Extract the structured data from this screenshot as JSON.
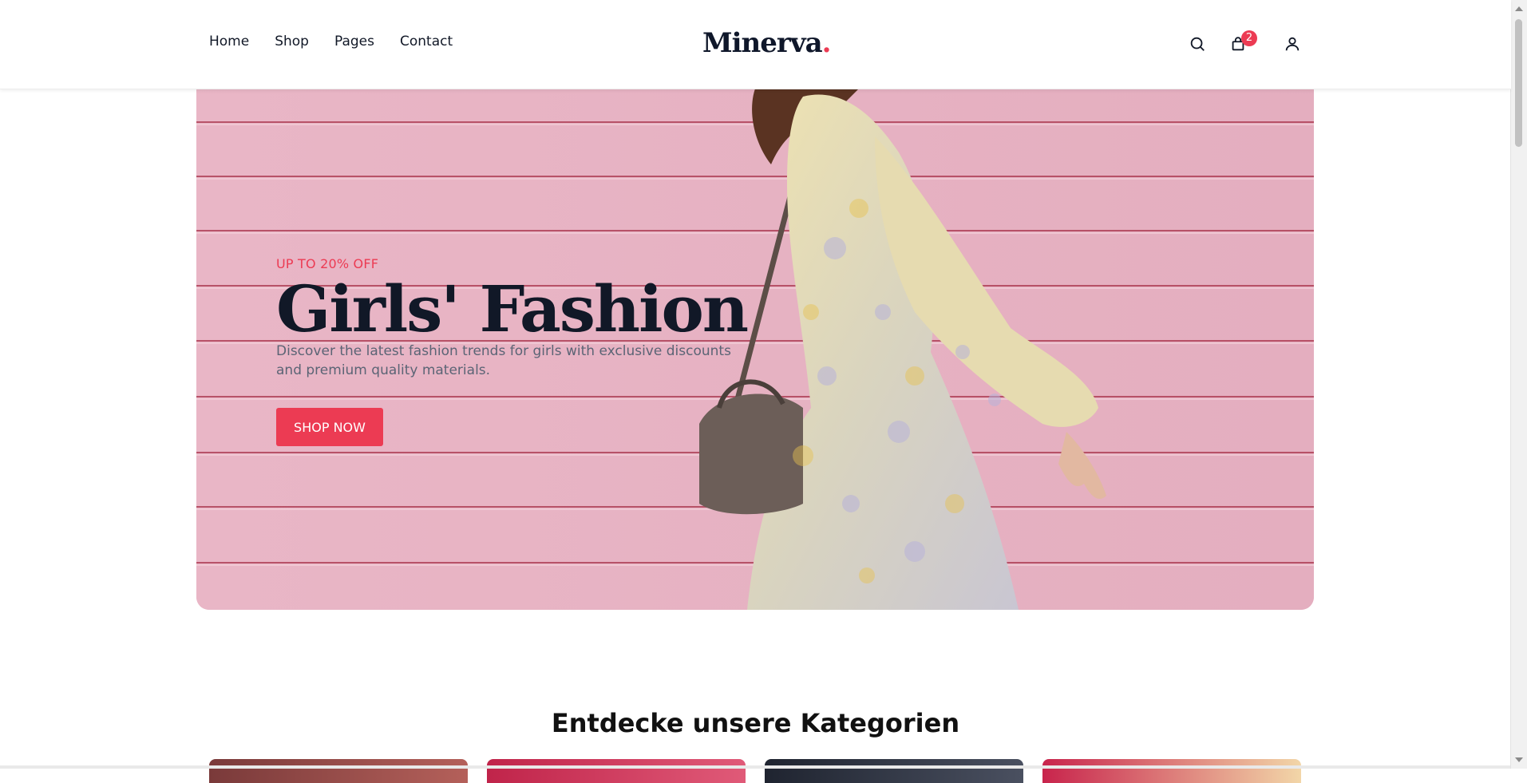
{
  "header": {
    "nav": [
      "Home",
      "Shop",
      "Pages",
      "Contact"
    ],
    "logo_text": "Minerva",
    "logo_dot": ".",
    "cart_count": "2",
    "icons": [
      "search-icon",
      "bag-icon",
      "user-icon"
    ]
  },
  "hero": {
    "eyebrow": "UP TO 20% OFF",
    "title": "Girls' Fashion",
    "subtitle": "Discover the latest fashion trends for girls with exclusive discounts and premium quality materials.",
    "cta": "SHOP NOW"
  },
  "categories": {
    "title": "Entdecke unsere Kategorien"
  },
  "colors": {
    "accent": "#ec3b53",
    "hero_background": "#e7b4c5",
    "text_dark": "#111827"
  }
}
